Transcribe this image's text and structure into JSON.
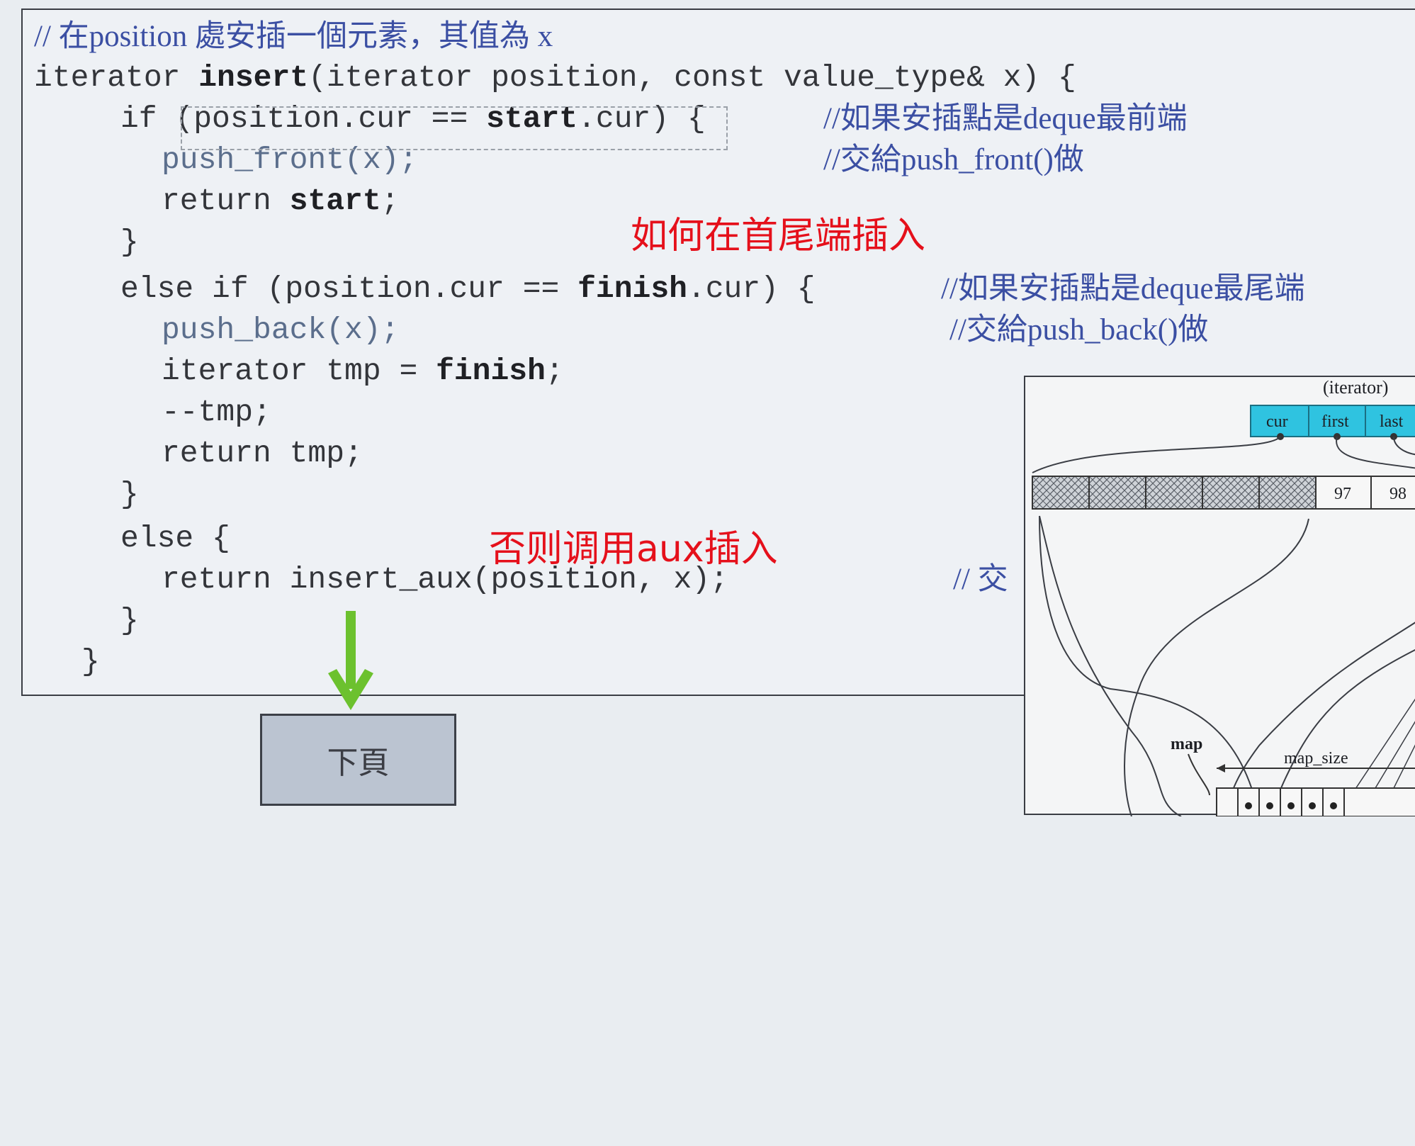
{
  "code": {
    "comment_title": "// 在position 處安插一個元素，其值為 x",
    "signature": {
      "prefix": "iterator ",
      "fn": "insert",
      "params": "(iterator position, const value_type& x) {"
    },
    "if_line": {
      "kw": "if ",
      "cond_pre": "(position.cur == ",
      "cond_bold": "start",
      "cond_post": ".cur) {",
      "comment": "//如果安插點是deque最前端"
    },
    "push_front_line": {
      "code": "push_front(x);",
      "comment": "//交給push_front()做"
    },
    "return_start": {
      "kw": "return ",
      "bold": "start",
      "end": ";"
    },
    "close1": "}",
    "elseif_line": {
      "kw": "else if ",
      "cond_pre": "(position.cur == ",
      "cond_bold": "finish",
      "cond_post": ".cur) {",
      "comment": "//如果安插點是deque最尾端"
    },
    "push_back_line": {
      "code": "push_back(x);",
      "comment": "//交給push_back()做"
    },
    "tmp_line": {
      "pre": "iterator tmp = ",
      "bold": "finish",
      "end": ";"
    },
    "dec_line": "--tmp;",
    "return_tmp": "return tmp;",
    "close2": "}",
    "else_line": "else {",
    "return_aux": {
      "code": "return insert_aux(position, x);",
      "comment": "// 交"
    },
    "close3": "}",
    "close4": "}"
  },
  "annotations": {
    "note1": "如何在首尾端插入",
    "note2": "否则调用aux插入"
  },
  "nav": {
    "next_label": "下頁"
  },
  "diagram": {
    "iterator_label": "(iterator)",
    "fields": [
      "cur",
      "first",
      "last"
    ],
    "cells": [
      "97",
      "98"
    ],
    "map_label": "map",
    "map_size_label": "map_size"
  },
  "colors": {
    "annotation": "#e5101b",
    "arrow": "#6cc12e",
    "iterator_cell": "#2fc3e0",
    "comment": "#3b4fa3"
  }
}
